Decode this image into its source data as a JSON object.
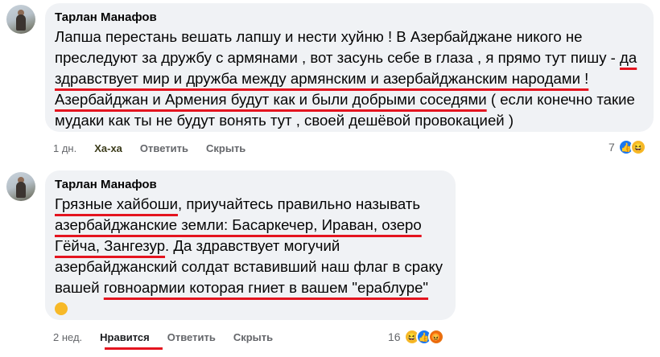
{
  "comments": [
    {
      "author": "Тарлан Манафов",
      "text_parts": [
        "Лапша перестань вешать лапшу и нести хуйню ! В Азербайджане никого не преследуют за дружбу с армянами , вот засунь себе в глаза , я прямо тут пишу - ",
        "да здравствует мир и дружба между армянским и азербайджанским народами !",
        " ",
        "Азербайджан и Армения будут как и были добрыми соседями",
        " ( если конечно такие мудаки как ты не будут вонять тут , своей дешёвой провокацией )"
      ],
      "time": "1 дн.",
      "like_label": "Ха-ха",
      "reply_label": "Ответить",
      "hide_label": "Скрыть",
      "reaction_count": "7",
      "reactions": [
        "like",
        "haha"
      ]
    },
    {
      "author": "Тарлан Манафов",
      "text_parts": [
        "Грязные хайбоши",
        ", приучайтесь правильно называть ",
        "азербайджанские земли: Басаркечер, Ираван, озеро Гёйча, Зангезур",
        ". Да здравствует могучий азербайджанский солдат вставивший наш флаг в сраку вашей ",
        "говноармии которая гниет в вашем \"ераблуре\""
      ],
      "time": "2 нед.",
      "like_label": "Нравится",
      "reply_label": "Ответить",
      "hide_label": "Скрыть",
      "reaction_count": "16",
      "reactions": [
        "haha",
        "like",
        "angry"
      ]
    }
  ],
  "colors": {
    "underline": "#e4141f",
    "bubble": "#f0f2f5",
    "like_blue": "#1877f2",
    "haha_yellow": "#f7b928"
  }
}
